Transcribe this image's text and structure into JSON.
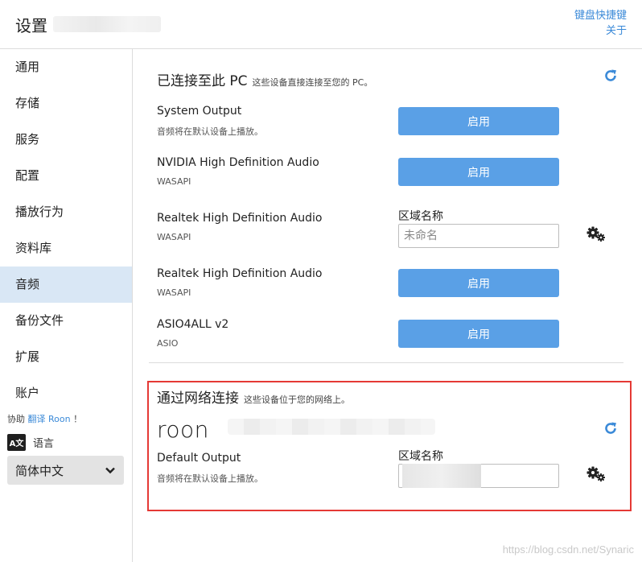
{
  "header": {
    "title": "设置",
    "links": [
      "键盘快捷键",
      "关于"
    ]
  },
  "sidebar": {
    "items": [
      {
        "label": "通用"
      },
      {
        "label": "存储"
      },
      {
        "label": "服务"
      },
      {
        "label": "配置"
      },
      {
        "label": "播放行为"
      },
      {
        "label": "资料库"
      },
      {
        "label": "音频",
        "active": true
      },
      {
        "label": "备份文件"
      },
      {
        "label": "扩展"
      },
      {
        "label": "账户"
      }
    ],
    "help": {
      "prefix": "协助",
      "link": "翻译 Roon",
      "suffix": "！"
    },
    "language": {
      "icon_text": "A文",
      "label": "语言",
      "selected": "简体中文"
    }
  },
  "local_section": {
    "title": "已连接至此 PC",
    "subtitle": "这些设备直接连接至您的 PC。",
    "devices": [
      {
        "name": "System Output",
        "sub": "音频将在默认设备上播放。",
        "action": "启用"
      },
      {
        "name": "NVIDIA High Definition Audio",
        "sub": "WASAPI",
        "action": "启用"
      },
      {
        "name": "Realtek High Definition Audio",
        "sub": "WASAPI",
        "zone_label": "区域名称",
        "zone_placeholder": "未命名"
      },
      {
        "name": "Realtek High Definition Audio",
        "sub": "WASAPI",
        "action": "启用"
      },
      {
        "name": "ASIO4ALL v2",
        "sub": "ASIO",
        "action": "启用"
      }
    ]
  },
  "network_section": {
    "title": "通过网络连接",
    "subtitle": "这些设备位于您的网络上。",
    "brand": "roon",
    "device": {
      "name": "Default Output",
      "sub": "音频将在默认设备上播放。",
      "zone_label": "区域名称"
    }
  },
  "watermark": "https://blog.csdn.net/Synaric",
  "colors": {
    "accent": "#5aa0e6",
    "link": "#3b8ad8",
    "active_bg": "#d9e7f5",
    "highlight": "#e53935"
  }
}
